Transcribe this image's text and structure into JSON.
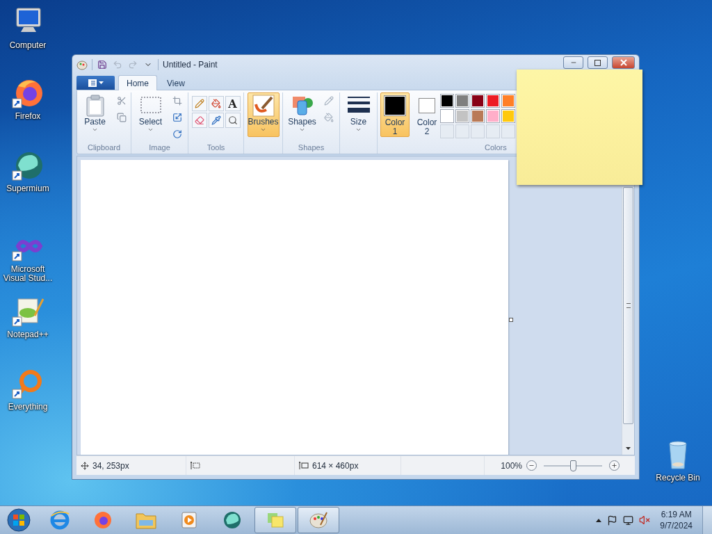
{
  "desktop_icons": [
    {
      "kind": "computer",
      "label": "Computer",
      "shortcut": false
    },
    {
      "kind": "firefox",
      "label": "Firefox",
      "shortcut": true
    },
    {
      "kind": "supermium",
      "label": "Supermium",
      "shortcut": true
    },
    {
      "kind": "visualstudio",
      "label": "Microsoft Visual Stud...",
      "shortcut": true
    },
    {
      "kind": "notepad",
      "label": "Notepad++",
      "shortcut": true
    },
    {
      "kind": "everything",
      "label": "Everything",
      "shortcut": true
    },
    {
      "kind": "recycle",
      "label": "Recycle Bin",
      "shortcut": false
    }
  ],
  "window": {
    "title": "Untitled - Paint"
  },
  "ribbon": {
    "tabs": [
      {
        "label": "Home",
        "selected": true
      },
      {
        "label": "View",
        "selected": false
      }
    ],
    "clipboard": {
      "label": "Clipboard",
      "paste": "Paste"
    },
    "image": {
      "label": "Image",
      "select": "Select"
    },
    "tools": {
      "label": "Tools",
      "text_tool": "A"
    },
    "brushes": {
      "label": "Brushes",
      "selected": true
    },
    "shapes": {
      "label": "Shapes",
      "button": "Shapes"
    },
    "size": {
      "label": "Size"
    },
    "colors": {
      "label": "Colors",
      "color1": {
        "label": "Color 1",
        "color": "#000000",
        "selected": true
      },
      "color2": {
        "label": "Color 2",
        "color": "#ffffff",
        "selected": false
      },
      "palette": [
        {
          "color": "#000000"
        },
        {
          "color": "#7f7f7f"
        },
        {
          "color": "#880015"
        },
        {
          "color": "#ed1c24"
        },
        {
          "color": "#ff7f27"
        },
        {
          "color": "#ffffff"
        },
        {
          "color": "#c3c3c3"
        },
        {
          "color": "#b97a57"
        },
        {
          "color": "#ffaec9"
        },
        {
          "color": "#ffc90e"
        }
      ]
    }
  },
  "status_bar": {
    "cursor": "34, 253px",
    "canvas_size": "614 × 460px",
    "zoom": "100%",
    "zoom_slider": {
      "level": 0.5
    }
  },
  "taskbar": {
    "items": [
      {
        "kind": "ie",
        "active": false
      },
      {
        "kind": "firefox",
        "active": false
      },
      {
        "kind": "explorer",
        "active": false
      },
      {
        "kind": "media",
        "active": false
      },
      {
        "kind": "supermium",
        "active": false
      },
      {
        "kind": "sticky",
        "active": true
      },
      {
        "kind": "paint",
        "active": true
      }
    ],
    "tray": {
      "time": "6:19 AM",
      "date": "9/7/2024",
      "volume_muted": true
    }
  }
}
